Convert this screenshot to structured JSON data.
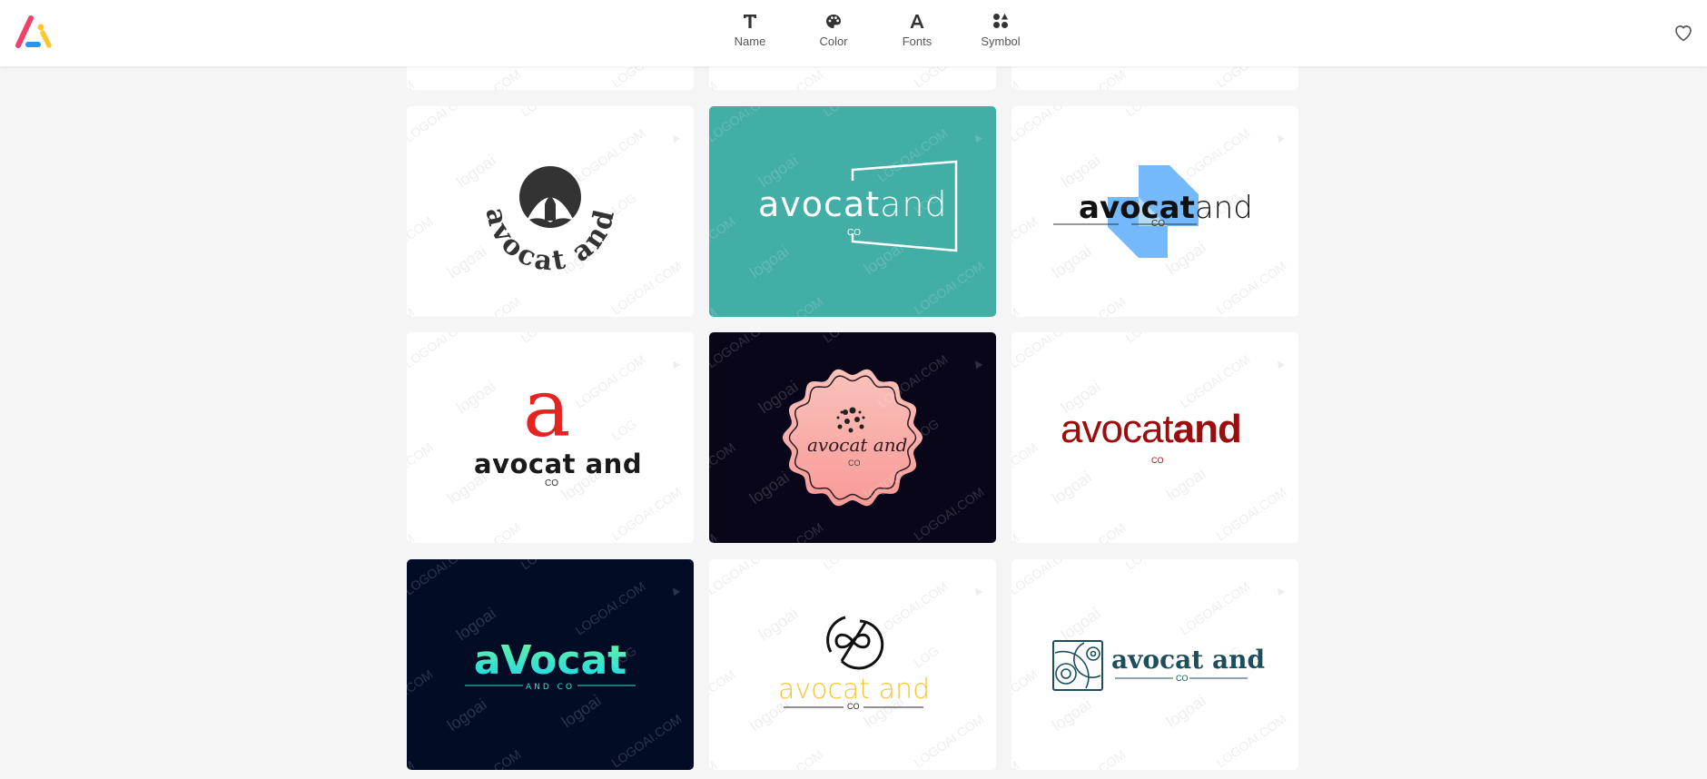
{
  "header": {
    "brand_icon": "logoai-triangle-icon",
    "nav": [
      {
        "label": "Name",
        "icon": "text-t-icon"
      },
      {
        "label": "Color",
        "icon": "palette-icon"
      },
      {
        "label": "Fonts",
        "icon": "font-a-icon"
      },
      {
        "label": "Symbol",
        "icon": "shapes-icon"
      }
    ],
    "favorites_icon": "heart-outline-icon"
  },
  "watermark": {
    "brand": "logoai",
    "domain": "LOGOAI.COM"
  },
  "colors": {
    "page_bg": "#f5f5f5",
    "brand_pink": "#f0416c",
    "brand_yellow": "#fcc72c",
    "brand_blue": "#2196f3"
  },
  "cards": [
    {
      "style": "arched-dark",
      "bg": "#ffffff",
      "name": "avocat and",
      "tagline": "",
      "text_color": "#333333"
    },
    {
      "style": "teal-frame",
      "bg": "#43aea6",
      "name_bold": "avocat",
      "name_light": "and",
      "tagline": "CO",
      "text_color": "#ffffff"
    },
    {
      "style": "blue-shape",
      "bg": "#ffffff",
      "name_bold": "avocat",
      "name_light": "and",
      "tagline": "CO",
      "text_color": "#111111",
      "accent": "#74b9fb"
    },
    {
      "style": "red-serif-a",
      "bg": "#ffffff",
      "monogram": "a",
      "name": "avocat and",
      "tagline": "CO",
      "text_color": "#1a1a1a",
      "accent": "#e52421"
    },
    {
      "style": "pink-badge",
      "bg": "#0a0619",
      "name": "avocat and",
      "tagline": "CO",
      "text_color": "#2b1a22",
      "accent": "#f8aaa5"
    },
    {
      "style": "maroon-wordmark",
      "bg": "#ffffff",
      "name_light": "avocat",
      "name_bold": "and",
      "tagline": "CO",
      "text_color": "#9c0d0d"
    },
    {
      "style": "neon-gradient",
      "bg": "#020d25",
      "name": "aVocat",
      "tagline": "AND CO",
      "text_color": "#35e0c4"
    },
    {
      "style": "infinity-circle",
      "bg": "#ffffff",
      "name": "avocat and",
      "tagline": "CO",
      "text_color": "#f5c535"
    },
    {
      "style": "spiral-box",
      "bg": "#ffffff",
      "name": "avocat and",
      "tagline": "CO",
      "text_color": "#1c4e5b"
    }
  ]
}
